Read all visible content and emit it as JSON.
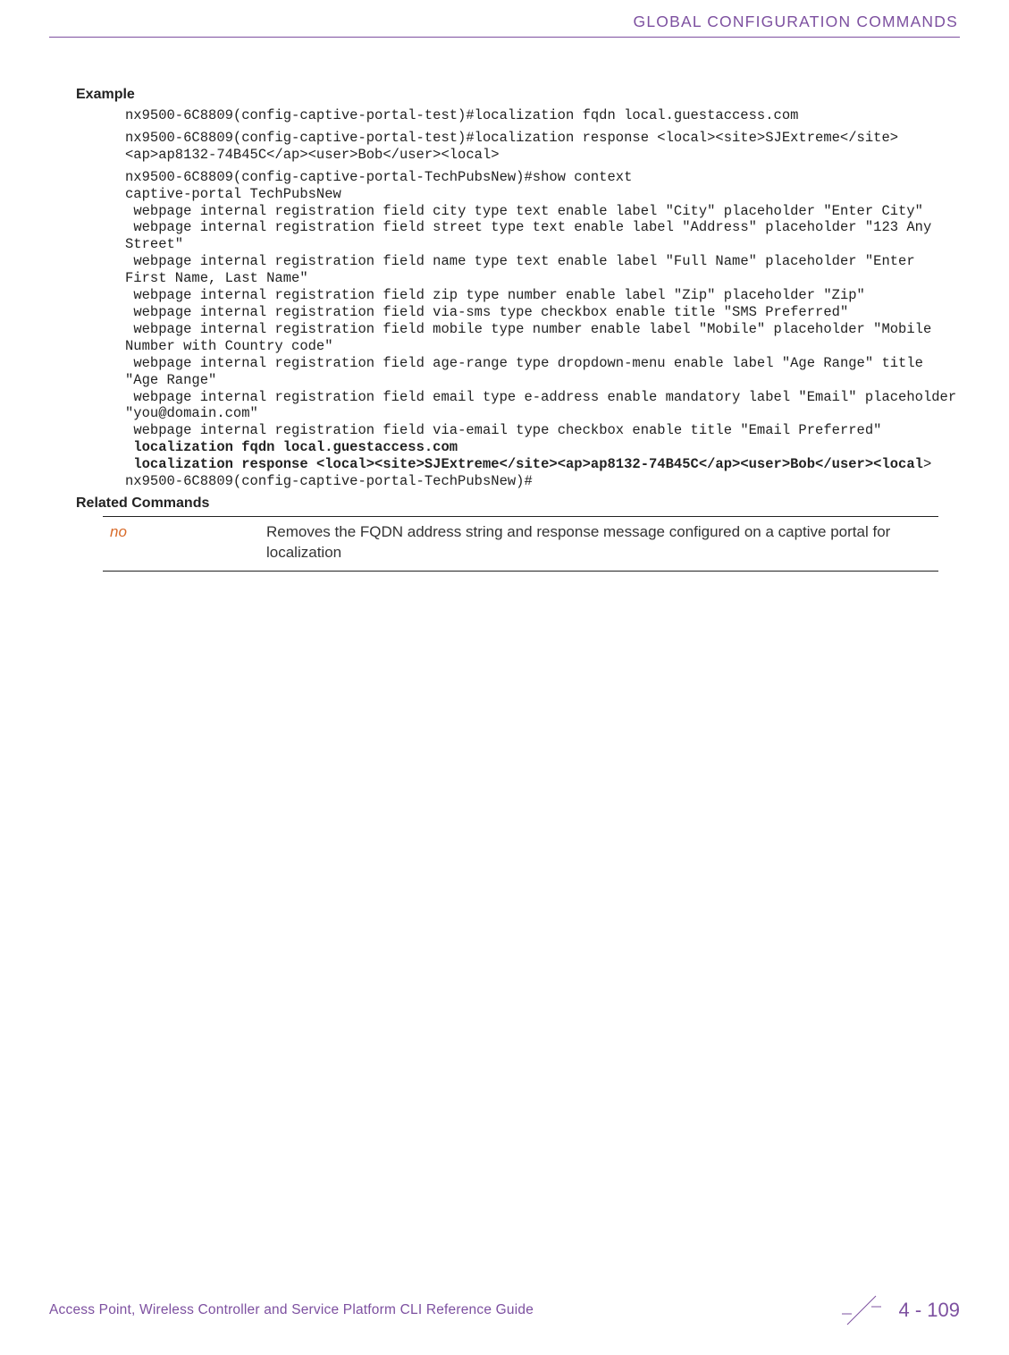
{
  "header": {
    "running_title": "GLOBAL CONFIGURATION COMMANDS"
  },
  "sections": {
    "example_label": "Example",
    "related_label": "Related Commands"
  },
  "code": {
    "line1": "nx9500-6C8809(config-captive-portal-test)#localization fqdn local.guestaccess.com",
    "line2": "nx9500-6C8809(config-captive-portal-test)#localization response <local><site>SJExtreme</site><ap>ap8132-74B45C</ap><user>Bob</user><local>",
    "line3": "nx9500-6C8809(config-captive-portal-TechPubsNew)#show context",
    "line4": "captive-portal TechPubsNew",
    "line5": " webpage internal registration field city type text enable label \"City\" placeholder \"Enter City\"",
    "line6": " webpage internal registration field street type text enable label \"Address\" placeholder \"123 Any Street\"",
    "line7": " webpage internal registration field name type text enable label \"Full Name\" placeholder \"Enter First Name, Last Name\"",
    "line8": " webpage internal registration field zip type number enable label \"Zip\" placeholder \"Zip\"",
    "line9": " webpage internal registration field via-sms type checkbox enable title \"SMS Preferred\"",
    "line10": " webpage internal registration field mobile type number enable label \"Mobile\" placeholder \"Mobile Number with Country code\"",
    "line11": " webpage internal registration field age-range type dropdown-menu enable label \"Age Range\" title \"Age Range\"",
    "line12": " webpage internal registration field email type e-address enable mandatory label \"Email\" placeholder \"you@domain.com\"",
    "line13": " webpage internal registration field via-email type checkbox enable title \"Email Preferred\"",
    "line14_bold": " localization fqdn local.guestaccess.com",
    "line15_bold": " localization response <local><site>SJExtreme</site><ap>ap8132-74B45C</ap><user>Bob</user><local",
    "line15_tail": ">",
    "line16": "nx9500-6C8809(config-captive-portal-TechPubsNew)#"
  },
  "related_table": {
    "command": "no",
    "description": "Removes the FQDN address string and response message configured on a captive portal for localization"
  },
  "footer": {
    "text": "Access Point, Wireless Controller and Service Platform CLI Reference Guide",
    "page": "4 - 109"
  }
}
